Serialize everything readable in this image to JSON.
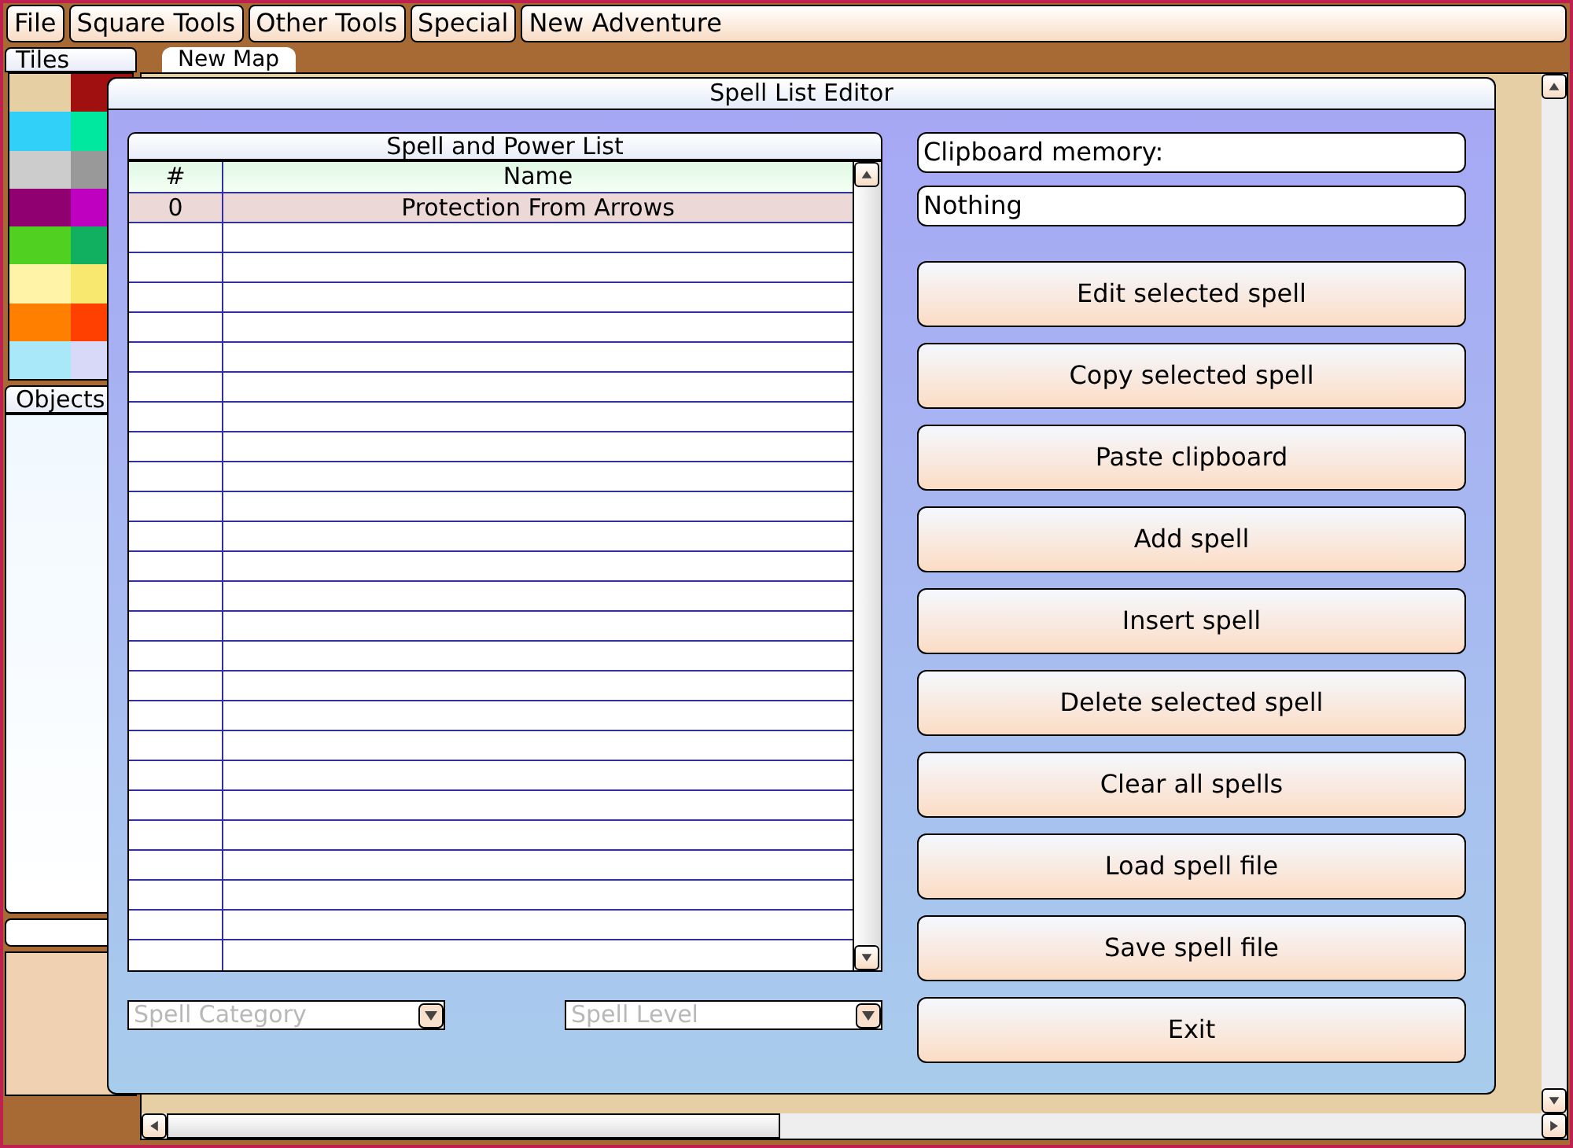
{
  "menu": [
    "File",
    "Square Tools",
    "Other Tools",
    "Special",
    "New Adventure"
  ],
  "sidebar": {
    "tiles_tab": "Tiles",
    "objects_tab": "Objects"
  },
  "map_tab": "New Map",
  "dialog": {
    "title": "Spell List Editor",
    "list": {
      "title": "Spell and Power List",
      "columns": [
        "#",
        "Name"
      ],
      "rows": [
        {
          "cells": [
            "0",
            "Protection From Arrows"
          ],
          "selected": true
        }
      ]
    },
    "category": {
      "placeholder": "Spell Category"
    },
    "level": {
      "placeholder": "Spell Level"
    },
    "clipboard_label": "Clipboard memory:",
    "clipboard_value": "Nothing",
    "buttons": [
      "Edit selected spell",
      "Copy selected spell",
      "Paste clipboard",
      "Add spell",
      "Insert spell",
      "Delete selected spell",
      "Clear all spells",
      "Load spell file",
      "Save spell file",
      "Exit"
    ]
  }
}
